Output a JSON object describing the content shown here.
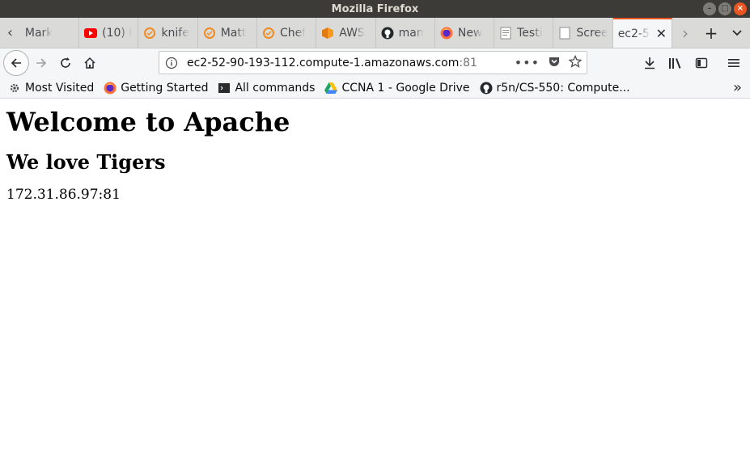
{
  "window": {
    "title": "Mozilla Firefox"
  },
  "tabs": [
    {
      "label": "Mark",
      "icon": "generic-page-icon"
    },
    {
      "label": "(10) I",
      "icon": "youtube-icon"
    },
    {
      "label": "knife",
      "icon": "chef-icon"
    },
    {
      "label": "Matt",
      "icon": "chef-icon"
    },
    {
      "label": "Chef",
      "icon": "chef-icon"
    },
    {
      "label": "AWS",
      "icon": "aws-icon"
    },
    {
      "label": "man",
      "icon": "github-icon"
    },
    {
      "label": "New",
      "icon": "firefox-icon"
    },
    {
      "label": "Testi",
      "icon": "document-icon"
    },
    {
      "label": "Scree",
      "icon": "blank-page-icon"
    }
  ],
  "active_tab": {
    "label": "ec2-5",
    "icon": "none"
  },
  "navbar": {
    "url_host": "ec2-52-90-193-112.compute-1.amazonaws.com",
    "url_port": ":81"
  },
  "bookmarks": [
    {
      "label": "Most Visited",
      "icon": "gear-icon"
    },
    {
      "label": "Getting Started",
      "icon": "firefox-icon"
    },
    {
      "label": "All commands",
      "icon": "terminal-icon"
    },
    {
      "label": "CCNA 1 - Google Drive",
      "icon": "google-drive-icon"
    },
    {
      "label": "r5n/CS-550: Compute...",
      "icon": "github-icon"
    }
  ],
  "page": {
    "heading": "Welcome to Apache",
    "subheading": "We love Tigers",
    "address": "172.31.86.97:81"
  },
  "colors": {
    "accent": "#e95420",
    "titlebar": "#3c3b37"
  }
}
